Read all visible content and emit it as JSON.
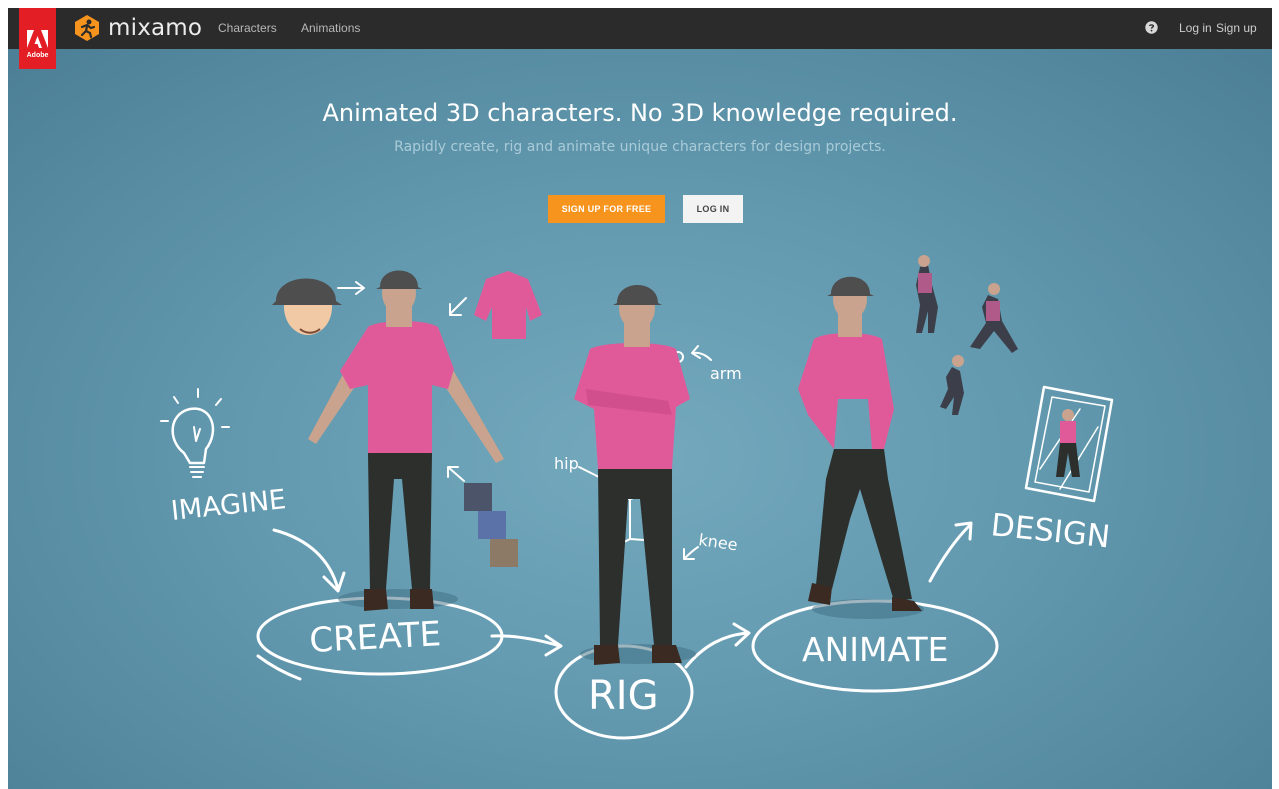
{
  "adobe": {
    "badge_text": "Adobe"
  },
  "brand": {
    "name": "mixamo"
  },
  "nav": {
    "characters": "Characters",
    "animations": "Animations",
    "login": "Log in",
    "signup": "Sign up"
  },
  "hero": {
    "title": "Animated 3D characters. No 3D knowledge required.",
    "subtitle": "Rapidly create, rig and animate unique characters for design projects.",
    "signup_button": "SIGN UP FOR FREE",
    "login_button": "LOG IN"
  },
  "illustration": {
    "imagine": "IMAGINE",
    "create": "CREATE",
    "rig": "RIG",
    "animate": "ANIMATE",
    "design": "DESIGN",
    "arm": "arm",
    "hip": "hip",
    "knee": "knee"
  },
  "colors": {
    "topbar": "#2b2b2b",
    "adobe_red": "#e31e24",
    "accent_orange": "#f7941e",
    "hero_blue": "#6299af",
    "shirt_pink": "#e05a9a"
  }
}
